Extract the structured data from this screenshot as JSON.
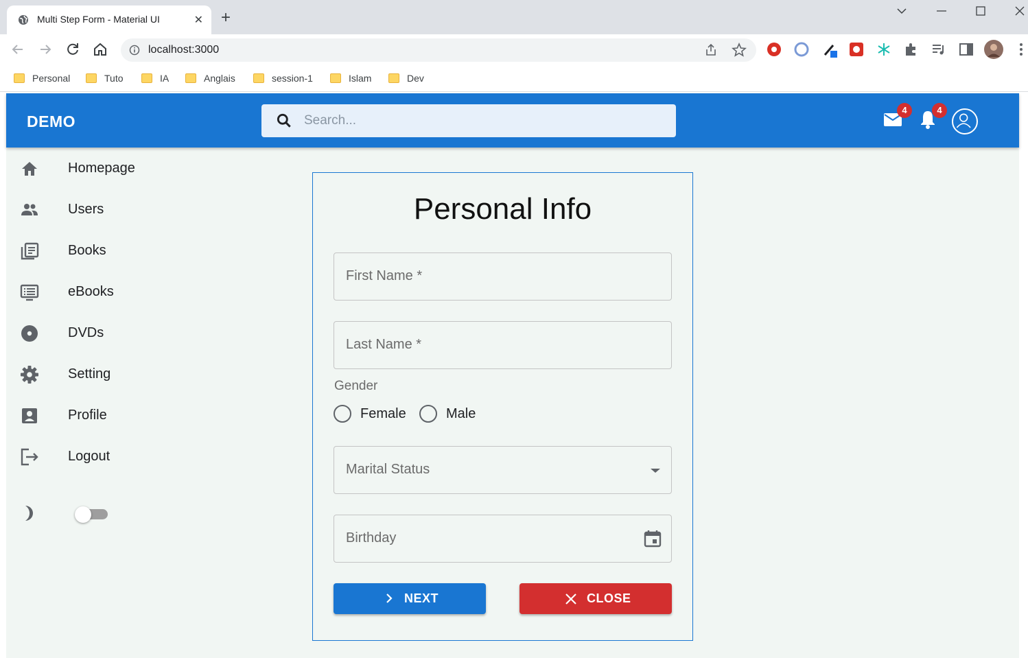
{
  "browser": {
    "tab_title": "Multi Step Form - Material UI",
    "url": "localhost:3000",
    "bookmarks": [
      "Personal",
      "Tuto",
      "IA",
      "Anglais",
      "session-1",
      "Islam",
      "Dev"
    ]
  },
  "app": {
    "brand": "DEMO",
    "search_placeholder": "Search...",
    "mail_badge": "4",
    "notification_badge": "4"
  },
  "sidebar": {
    "items": [
      {
        "label": "Homepage",
        "icon": "home-icon"
      },
      {
        "label": "Users",
        "icon": "users-icon"
      },
      {
        "label": "Books",
        "icon": "books-icon"
      },
      {
        "label": "eBooks",
        "icon": "ebooks-icon"
      },
      {
        "label": "DVDs",
        "icon": "disc-icon"
      },
      {
        "label": "Setting",
        "icon": "gear-icon"
      },
      {
        "label": "Profile",
        "icon": "profile-icon"
      },
      {
        "label": "Logout",
        "icon": "logout-icon"
      }
    ],
    "dark_mode_on": false
  },
  "form": {
    "title": "Personal Info",
    "first_name_label": "First Name *",
    "last_name_label": "Last Name *",
    "gender_label": "Gender",
    "gender_options": [
      "Female",
      "Male"
    ],
    "marital_status_label": "Marital Status",
    "birthday_label": "Birthday",
    "next_label": "NEXT",
    "close_label": "CLOSE"
  },
  "colors": {
    "primary": "#1976d2",
    "danger": "#d32f2f",
    "background": "#f1f6f3"
  }
}
